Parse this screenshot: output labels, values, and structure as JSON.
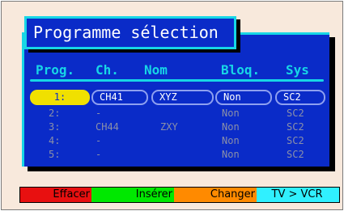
{
  "title": "Programme sélection",
  "headers": {
    "prog": "Prog.",
    "ch": "Ch.",
    "nom": "Nom",
    "bloq": "Bloq.",
    "sys": "Sys"
  },
  "rows": [
    {
      "prog": "1:",
      "ch": "CH41",
      "nom": "XYZ",
      "bloq": "Non",
      "sys": "SC2"
    },
    {
      "prog": "2:",
      "ch": "-",
      "nom": "",
      "bloq": "Non",
      "sys": "SC2"
    },
    {
      "prog": "3:",
      "ch": "CH44",
      "nom": "ZXY",
      "bloq": "Non",
      "sys": "SC2"
    },
    {
      "prog": "4:",
      "ch": "-",
      "nom": "",
      "bloq": "Non",
      "sys": "SC2"
    },
    {
      "prog": "5:",
      "ch": "-",
      "nom": "",
      "bloq": "Non",
      "sys": "SC2"
    }
  ],
  "buttons": {
    "effacer": "Effacer",
    "inserer": "Insérer",
    "changer": "Changer",
    "tv_vcr": "TV > VCR"
  },
  "colors": {
    "panel": "#0a2bc8",
    "accent": "#17d6e6",
    "selection": "#f0e000",
    "effacer": "#e81010",
    "inserer": "#00e800",
    "changer": "#ff8a00",
    "tv_vcr": "#30f0ff"
  }
}
